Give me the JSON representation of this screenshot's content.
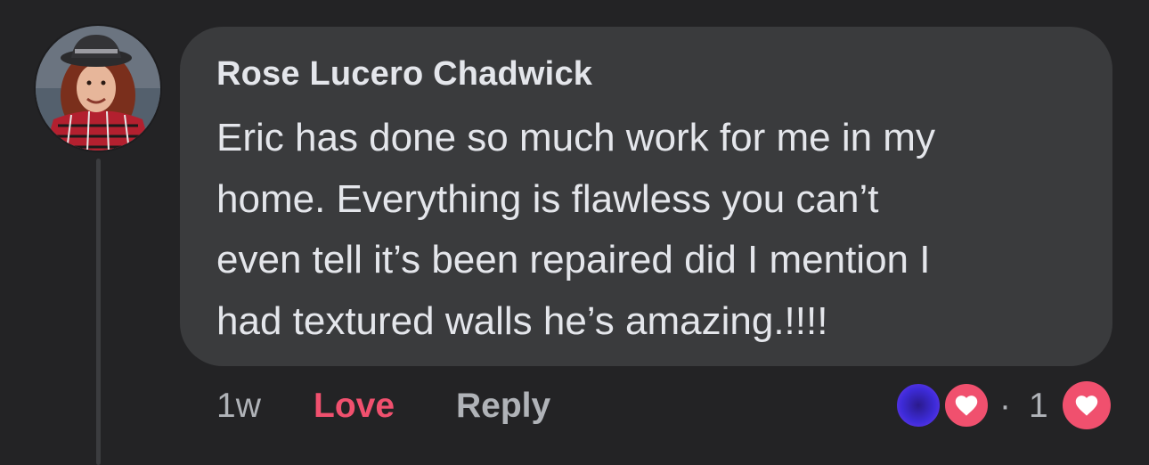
{
  "comment": {
    "author": "Rose Lucero Chadwick",
    "text": "Eric has done so much work for me in my\nhome. Everything is flawless you can’t\neven tell it’s been repaired did I mention I\nhad textured walls he’s amazing.!!!!",
    "timestamp": "1w",
    "love_label": "Love",
    "reply_label": "Reply",
    "reaction_separator": "·",
    "reaction_count": "1"
  },
  "colors": {
    "background": "#232325",
    "bubble": "#3a3b3d",
    "text": "#e4e6eb",
    "muted": "#b0b3b8",
    "love": "#f0506e"
  },
  "icons": {
    "avatar": "profile-photo",
    "reactor_avatar": "reactor-avatar-icon",
    "reaction": "heart-icon",
    "my_reaction": "heart-icon"
  }
}
